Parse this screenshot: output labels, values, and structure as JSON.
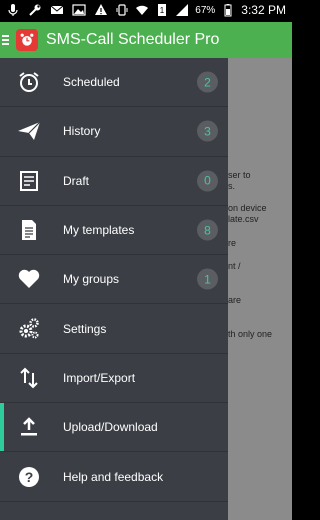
{
  "status_bar": {
    "battery_percent": "67%",
    "time": "3:32 PM",
    "left_icons": [
      "mic-icon",
      "wrench-icon",
      "mail-icon",
      "image-icon",
      "warning-icon"
    ],
    "right_icons": [
      "vibrate-icon",
      "wifi-icon",
      "sim-icon",
      "signal-icon",
      "battery-icon"
    ]
  },
  "app_bar": {
    "title": "SMS-Call Scheduler Pro",
    "logo_icon": "alarm-clock-icon",
    "accent_color": "#4caf50"
  },
  "drawer": {
    "background_color": "#3b3f45",
    "badge_text_color": "#4fc3a1",
    "active_marker_color": "#2ecc9a",
    "items": [
      {
        "label": "Scheduled",
        "badge": "2",
        "icon": "alarm-clock-icon",
        "active": false
      },
      {
        "label": "History",
        "badge": "3",
        "icon": "paper-plane-icon",
        "active": false
      },
      {
        "label": "Draft",
        "badge": "0",
        "icon": "draft-document-icon",
        "active": false
      },
      {
        "label": "My templates",
        "badge": "8",
        "icon": "templates-document-icon",
        "active": false
      },
      {
        "label": "My groups",
        "badge": "1",
        "icon": "heart-icon",
        "active": false
      },
      {
        "label": "Settings",
        "badge": null,
        "icon": "gears-icon",
        "active": false
      },
      {
        "label": "Import/Export",
        "badge": null,
        "icon": "import-export-arrows-icon",
        "active": false
      },
      {
        "label": "Upload/Download",
        "badge": null,
        "icon": "upload-icon",
        "active": true
      },
      {
        "label": "Help and feedback",
        "badge": null,
        "icon": "help-question-icon",
        "active": false
      }
    ]
  },
  "background_content": {
    "lines": [
      "ser to",
      "s.",
      "on device",
      "late.csv",
      "re",
      "nt /",
      "are",
      "th only one"
    ]
  }
}
